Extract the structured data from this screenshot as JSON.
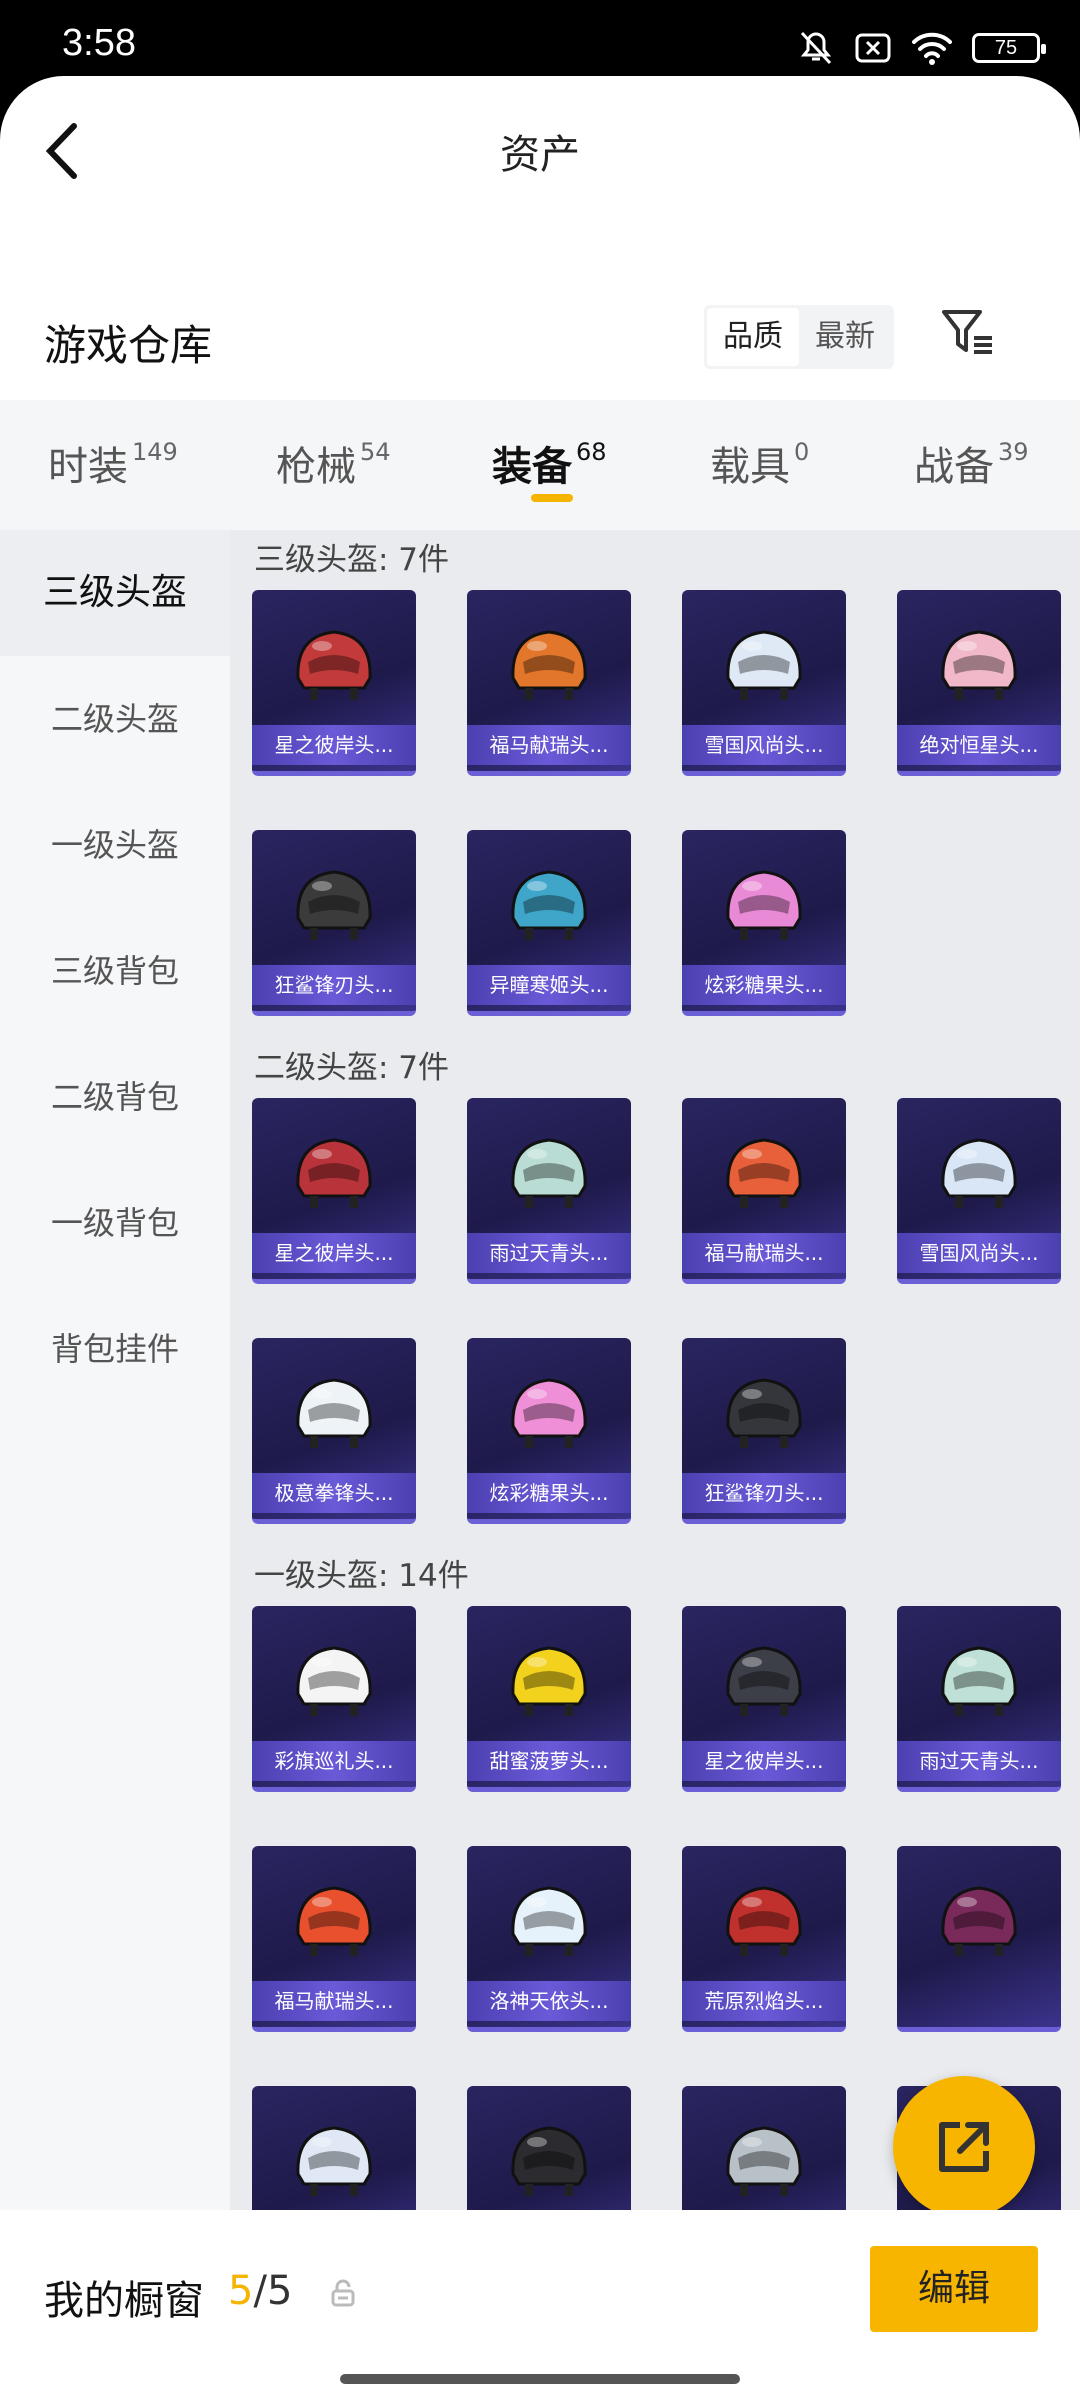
{
  "status_bar": {
    "time": "3:58",
    "battery": "75",
    "icons": [
      "mute-icon",
      "no-sim-icon",
      "wifi-icon",
      "battery-icon"
    ]
  },
  "header": {
    "title": "资产",
    "back_icon": "chevron-left-icon"
  },
  "warehouse": {
    "title": "游戏仓库",
    "sort_options": [
      "品质",
      "最新"
    ],
    "sort_selected": "品质",
    "filter_icon": "filter-list-icon"
  },
  "tabs": [
    {
      "label": "时装",
      "count": "149"
    },
    {
      "label": "枪械",
      "count": "54"
    },
    {
      "label": "装备",
      "count": "68"
    },
    {
      "label": "载具",
      "count": "0"
    },
    {
      "label": "战备",
      "count": "39"
    }
  ],
  "tab_selected": "装备",
  "sidebar": {
    "items": [
      {
        "label": "三级头盔"
      },
      {
        "label": "二级头盔"
      },
      {
        "label": "一级头盔"
      },
      {
        "label": "三级背包"
      },
      {
        "label": "二级背包"
      },
      {
        "label": "一级背包"
      },
      {
        "label": "背包挂件"
      }
    ],
    "selected": "三级头盔"
  },
  "sections": [
    {
      "title": "三级头盔: 7件",
      "items": [
        {
          "name": "星之彼岸头...",
          "color": "#c23a3a"
        },
        {
          "name": "福马献瑞头...",
          "color": "#e2762b"
        },
        {
          "name": "雪国风尚头...",
          "color": "#dfe9f5"
        },
        {
          "name": "绝对恒星头...",
          "color": "#f0b8c9"
        },
        {
          "name": "狂鲨锋刃头...",
          "color": "#3b3b3b"
        },
        {
          "name": "异瞳寒姬头...",
          "color": "#3fa6c9"
        },
        {
          "name": "炫彩糖果头...",
          "color": "#e98ad6"
        }
      ]
    },
    {
      "title": "二级头盔: 7件",
      "items": [
        {
          "name": "星之彼岸头...",
          "color": "#b8343a"
        },
        {
          "name": "雨过天青头...",
          "color": "#b9dcd4"
        },
        {
          "name": "福马献瑞头...",
          "color": "#e8603a"
        },
        {
          "name": "雪国风尚头...",
          "color": "#d9e6f6"
        },
        {
          "name": "极意拳锋头...",
          "color": "#eef3f8"
        },
        {
          "name": "炫彩糖果头...",
          "color": "#ef8fd8"
        },
        {
          "name": "狂鲨锋刃头...",
          "color": "#34363c"
        }
      ]
    },
    {
      "title": "一级头盔: 14件",
      "items": [
        {
          "name": "彩旗巡礼头...",
          "color": "#f4f4f4"
        },
        {
          "name": "甜蜜菠萝头...",
          "color": "#f2d21c"
        },
        {
          "name": "星之彼岸头...",
          "color": "#3c3e48"
        },
        {
          "name": "雨过天青头...",
          "color": "#bfe0d6"
        },
        {
          "name": "福马献瑞头...",
          "color": "#e8502e"
        },
        {
          "name": "洛神天依头...",
          "color": "#e6f2fb"
        },
        {
          "name": "荒原烈焰头...",
          "color": "#c0302c"
        },
        {
          "name": "",
          "color": "#7a2a5a"
        },
        {
          "name": "",
          "color": "#dfe8f4"
        },
        {
          "name": "",
          "color": "#2c2c30"
        },
        {
          "name": "",
          "color": "#b8c0c8"
        },
        {
          "name": "",
          "color": "#f0c6d6"
        }
      ]
    }
  ],
  "bottom_bar": {
    "label": "我的橱窗",
    "count_current": "5",
    "count_sep": "/",
    "count_total": "5",
    "lock_icon": "lock-icon",
    "edit_label": "编辑"
  },
  "fab": {
    "icon": "external-link-icon"
  },
  "colors": {
    "accent": "#f7b500",
    "card_bg": "#241f55",
    "card_name_bg": "#5a4cc4"
  }
}
